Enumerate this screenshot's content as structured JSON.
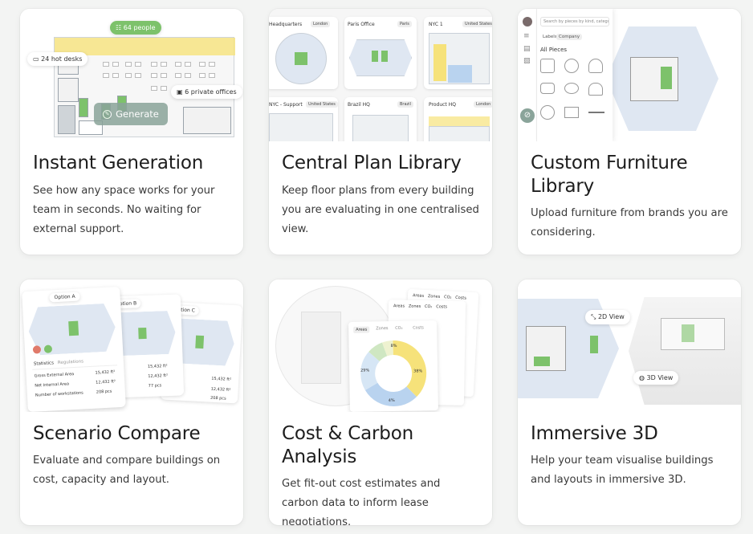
{
  "cards": [
    {
      "title": "Instant Generation",
      "desc": "See how any space works for your team in seconds. No waiting for external support.",
      "illustration": {
        "people_pill": "64 people",
        "hot_desks_pill": "24 hot desks",
        "private_pill": "6 private offices",
        "generate_button": "Generate"
      }
    },
    {
      "title": "Central Plan Library",
      "desc": "Keep floor plans from every building you are evaluating in one centralised view.",
      "illustration": {
        "plans": [
          {
            "name": "Headquarters",
            "tag": "London"
          },
          {
            "name": "Paris Office",
            "tag": "Paris"
          },
          {
            "name": "NYC 1",
            "tag": "United States"
          },
          {
            "name": "NYC - Support",
            "tag": "United States"
          },
          {
            "name": "Brazil HQ",
            "tag": "Brazil"
          },
          {
            "name": "Product HQ",
            "tag": "London"
          }
        ]
      }
    },
    {
      "title": "Custom Furniture Library",
      "desc": "Upload furniture from brands you are considering.",
      "illustration": {
        "search_placeholder": "Search by pieces by kind, category",
        "tab_labels": "Labels",
        "tab_company": "Company",
        "all_pieces": "All Pieces"
      }
    },
    {
      "title": "Scenario Compare",
      "desc": "Evaluate and compare buildings on cost, capacity and layout.",
      "illustration": {
        "option_a": "Option A",
        "option_b": "Option B",
        "option_c": "Option C",
        "tab_statistics": "Statistics",
        "tab_regulations": "Regulations",
        "rows": [
          {
            "label": "Gross External Area",
            "value": "15,432 ft²"
          },
          {
            "label": "Net Internal Area",
            "value": "12,432 ft²"
          },
          {
            "label": "Number of workstations",
            "value": "208 pcs"
          }
        ],
        "c_values": [
          "15,432 ft²",
          "12,432 ft²",
          "208 pcs"
        ],
        "b_values": [
          "15,432 ft²",
          "12,432 ft²",
          "77 pcs"
        ]
      }
    },
    {
      "title": "Cost & Carbon Analysis",
      "desc": "Get fit-out cost estimates and carbon data to inform lease negotiations.",
      "illustration": {
        "tabs": [
          "Areas",
          "Zones",
          "CO₂",
          "Costs"
        ],
        "donut_labels": [
          "29%",
          "38%",
          "8%",
          "4%"
        ]
      }
    },
    {
      "title": "Immersive 3D",
      "desc": "Help your team visualise buildings and layouts in immersive 3D.",
      "illustration": {
        "view_2d": "2D View",
        "view_3d": "3D View"
      }
    }
  ],
  "colors": {
    "green": "#7dc26b",
    "yellow": "#f6e27a",
    "blue": "#b9d3ef",
    "generate_btn": "#8aa49a"
  }
}
